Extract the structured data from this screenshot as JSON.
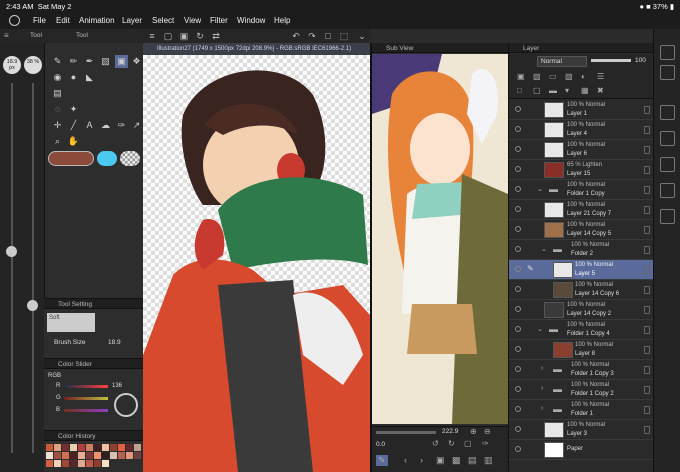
{
  "status": {
    "time": "2:43 AM",
    "date": "Sat May 2",
    "battery": "37%"
  },
  "menu": [
    "File",
    "Edit",
    "Animation",
    "Layer",
    "Select",
    "View",
    "Filter",
    "Window",
    "Help"
  ],
  "document": {
    "tab": "Illustration27 (1749 x 1500px 72dpi 208.9%) - RGB:sRGB IEC61966-2.1)"
  },
  "brush": {
    "size1": "18.9 px",
    "size2": "38 %"
  },
  "panels": {
    "tool": "Tool",
    "tool2": "Tool",
    "tool_settings": "Tool Setting",
    "soft": "Soft",
    "brush_size": "Brush Size",
    "brush_val": "18.9",
    "color_slider": "Color Slider",
    "rgb": "RGB",
    "r": "R",
    "r_val": "136",
    "g": "G",
    "b": "B",
    "color_history": "Color History",
    "sub_view": "Sub View",
    "layer": "Layer",
    "blend": "Normal",
    "opacity": "100"
  },
  "zoom": "222.9",
  "sub_zoom": "0.0",
  "layers": [
    {
      "blend": "100 % Normal",
      "name": "Layer 1"
    },
    {
      "blend": "100 % Normal",
      "name": "Layer 4"
    },
    {
      "blend": "100 % Normal",
      "name": "Layer 6"
    },
    {
      "blend": "65 % Lighten",
      "name": "Layer 15"
    },
    {
      "blend": "100 % Normal",
      "name": "Folder 1 Copy"
    },
    {
      "blend": "100 % Normal",
      "name": "Layer 21 Copy 7"
    },
    {
      "blend": "100 % Normal",
      "name": "Layer 14 Copy 5"
    },
    {
      "blend": "100 % Normal",
      "name": "Folder 2"
    },
    {
      "blend": "100 % Normal",
      "name": "Layer 5"
    },
    {
      "blend": "100 % Normal",
      "name": "Layer 14 Copy 6"
    },
    {
      "blend": "100 % Normal",
      "name": "Layer 14 Copy 2"
    },
    {
      "blend": "100 % Normal",
      "name": "Folder 1 Copy 4"
    },
    {
      "blend": "100 % Normal",
      "name": "Layer 8"
    },
    {
      "blend": "100 % Normal",
      "name": "Folder 1 Copy 3"
    },
    {
      "blend": "100 % Normal",
      "name": "Folder 1 Copy 2"
    },
    {
      "blend": "100 % Normal",
      "name": "Folder 1"
    },
    {
      "blend": "100 % Normal",
      "name": "Layer 3"
    },
    {
      "blend": "",
      "name": "Paper"
    }
  ],
  "colors": {
    "main": "#8b4a3a",
    "sub": "#4cc9f0",
    "accent": "#4a7fd6",
    "selected": "#5a6a9a"
  }
}
